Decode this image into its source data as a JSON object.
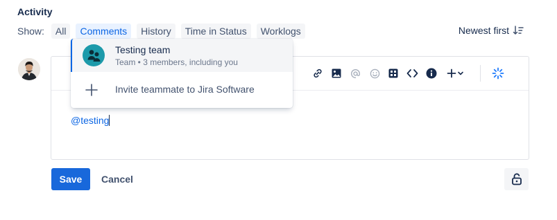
{
  "activity": {
    "title": "Activity"
  },
  "filters": {
    "show_label": "Show:",
    "chips": [
      {
        "label": "All",
        "active": false
      },
      {
        "label": "Comments",
        "active": true
      },
      {
        "label": "History",
        "active": false
      },
      {
        "label": "Time in Status",
        "active": false
      },
      {
        "label": "Worklogs",
        "active": false
      }
    ]
  },
  "sort": {
    "label": "Newest first",
    "icon": "sort-descending-icon"
  },
  "editor": {
    "content": "@testing",
    "toolbar_icons": [
      "link-icon",
      "image-icon",
      "mention-icon",
      "emoji-icon",
      "table-icon",
      "code-icon",
      "info-icon",
      "plus-icon",
      "chevron-down-icon",
      "loading-spinner-icon"
    ]
  },
  "mention_dropdown": {
    "items": [
      {
        "title": "Testing team",
        "subtitle": "Team • 3 members, including you",
        "icon": "team-icon"
      }
    ],
    "invite_label": "Invite teammate to Jira Software"
  },
  "actions": {
    "save_label": "Save",
    "cancel_label": "Cancel",
    "lock_icon": "unlock-icon"
  },
  "colors": {
    "accent": "#0c66e4",
    "save_bg": "#1868db",
    "team_avatar": "#1d9aaa",
    "spinner": "#1d7afc"
  }
}
